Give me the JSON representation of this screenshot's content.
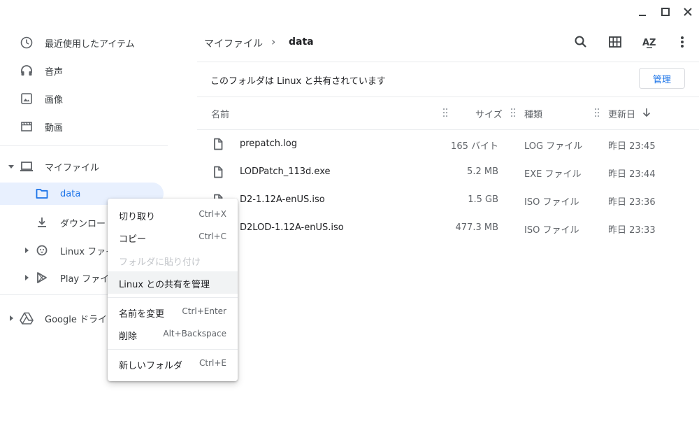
{
  "window": {
    "minimize_icon": "minimize-icon",
    "maximize_icon": "maximize-icon",
    "close_icon": "close-icon"
  },
  "sidebar": {
    "recent": "最近使用したアイテム",
    "audio": "音声",
    "images": "画像",
    "videos": "動画",
    "my_files": "マイファイル",
    "data": "data",
    "downloads": "ダウンロード",
    "linux_files": "Linux ファイル",
    "play_files": "Play ファイル",
    "google_drive": "Google ドライブ"
  },
  "breadcrumb": {
    "root": "マイファイル",
    "separator": "›",
    "current": "data"
  },
  "toolbar": {
    "search": "search-icon",
    "grid": "grid-view-icon",
    "sort": "sort-az-icon",
    "more": "more-vert-icon"
  },
  "banner": {
    "text": "このフォルダは Linux と共有されています",
    "manage_label": "管理"
  },
  "table": {
    "headers": {
      "name": "名前",
      "size": "サイズ",
      "type": "種類",
      "modified": "更新日"
    },
    "rows": [
      {
        "name": "prepatch.log",
        "size": "165 バイト",
        "type": "LOG ファイル",
        "modified": "昨日 23:45"
      },
      {
        "name": "LODPatch_113d.exe",
        "size": "5.2 MB",
        "type": "EXE ファイル",
        "modified": "昨日 23:44"
      },
      {
        "name": "D2-1.12A-enUS.iso",
        "size": "1.5 GB",
        "type": "ISO ファイル",
        "modified": "昨日 23:36"
      },
      {
        "name": "D2LOD-1.12A-enUS.iso",
        "size": "477.3 MB",
        "type": "ISO ファイル",
        "modified": "昨日 23:33"
      }
    ]
  },
  "context_menu": {
    "cut": {
      "label": "切り取り",
      "shortcut": "Ctrl+X"
    },
    "copy": {
      "label": "コピー",
      "shortcut": "Ctrl+C"
    },
    "paste_into_folder": {
      "label": "フォルダに貼り付け",
      "shortcut": ""
    },
    "manage_linux_sharing": {
      "label": "Linux との共有を管理",
      "shortcut": ""
    },
    "rename": {
      "label": "名前を変更",
      "shortcut": "Ctrl+Enter"
    },
    "delete": {
      "label": "削除",
      "shortcut": "Alt+Backspace"
    },
    "new_folder": {
      "label": "新しいフォルダ",
      "shortcut": "Ctrl+E"
    }
  },
  "colors": {
    "accent": "#1a73e8",
    "selected_bg": "#e8f0fe",
    "text": "#202124",
    "secondary_text": "#5f6368"
  }
}
